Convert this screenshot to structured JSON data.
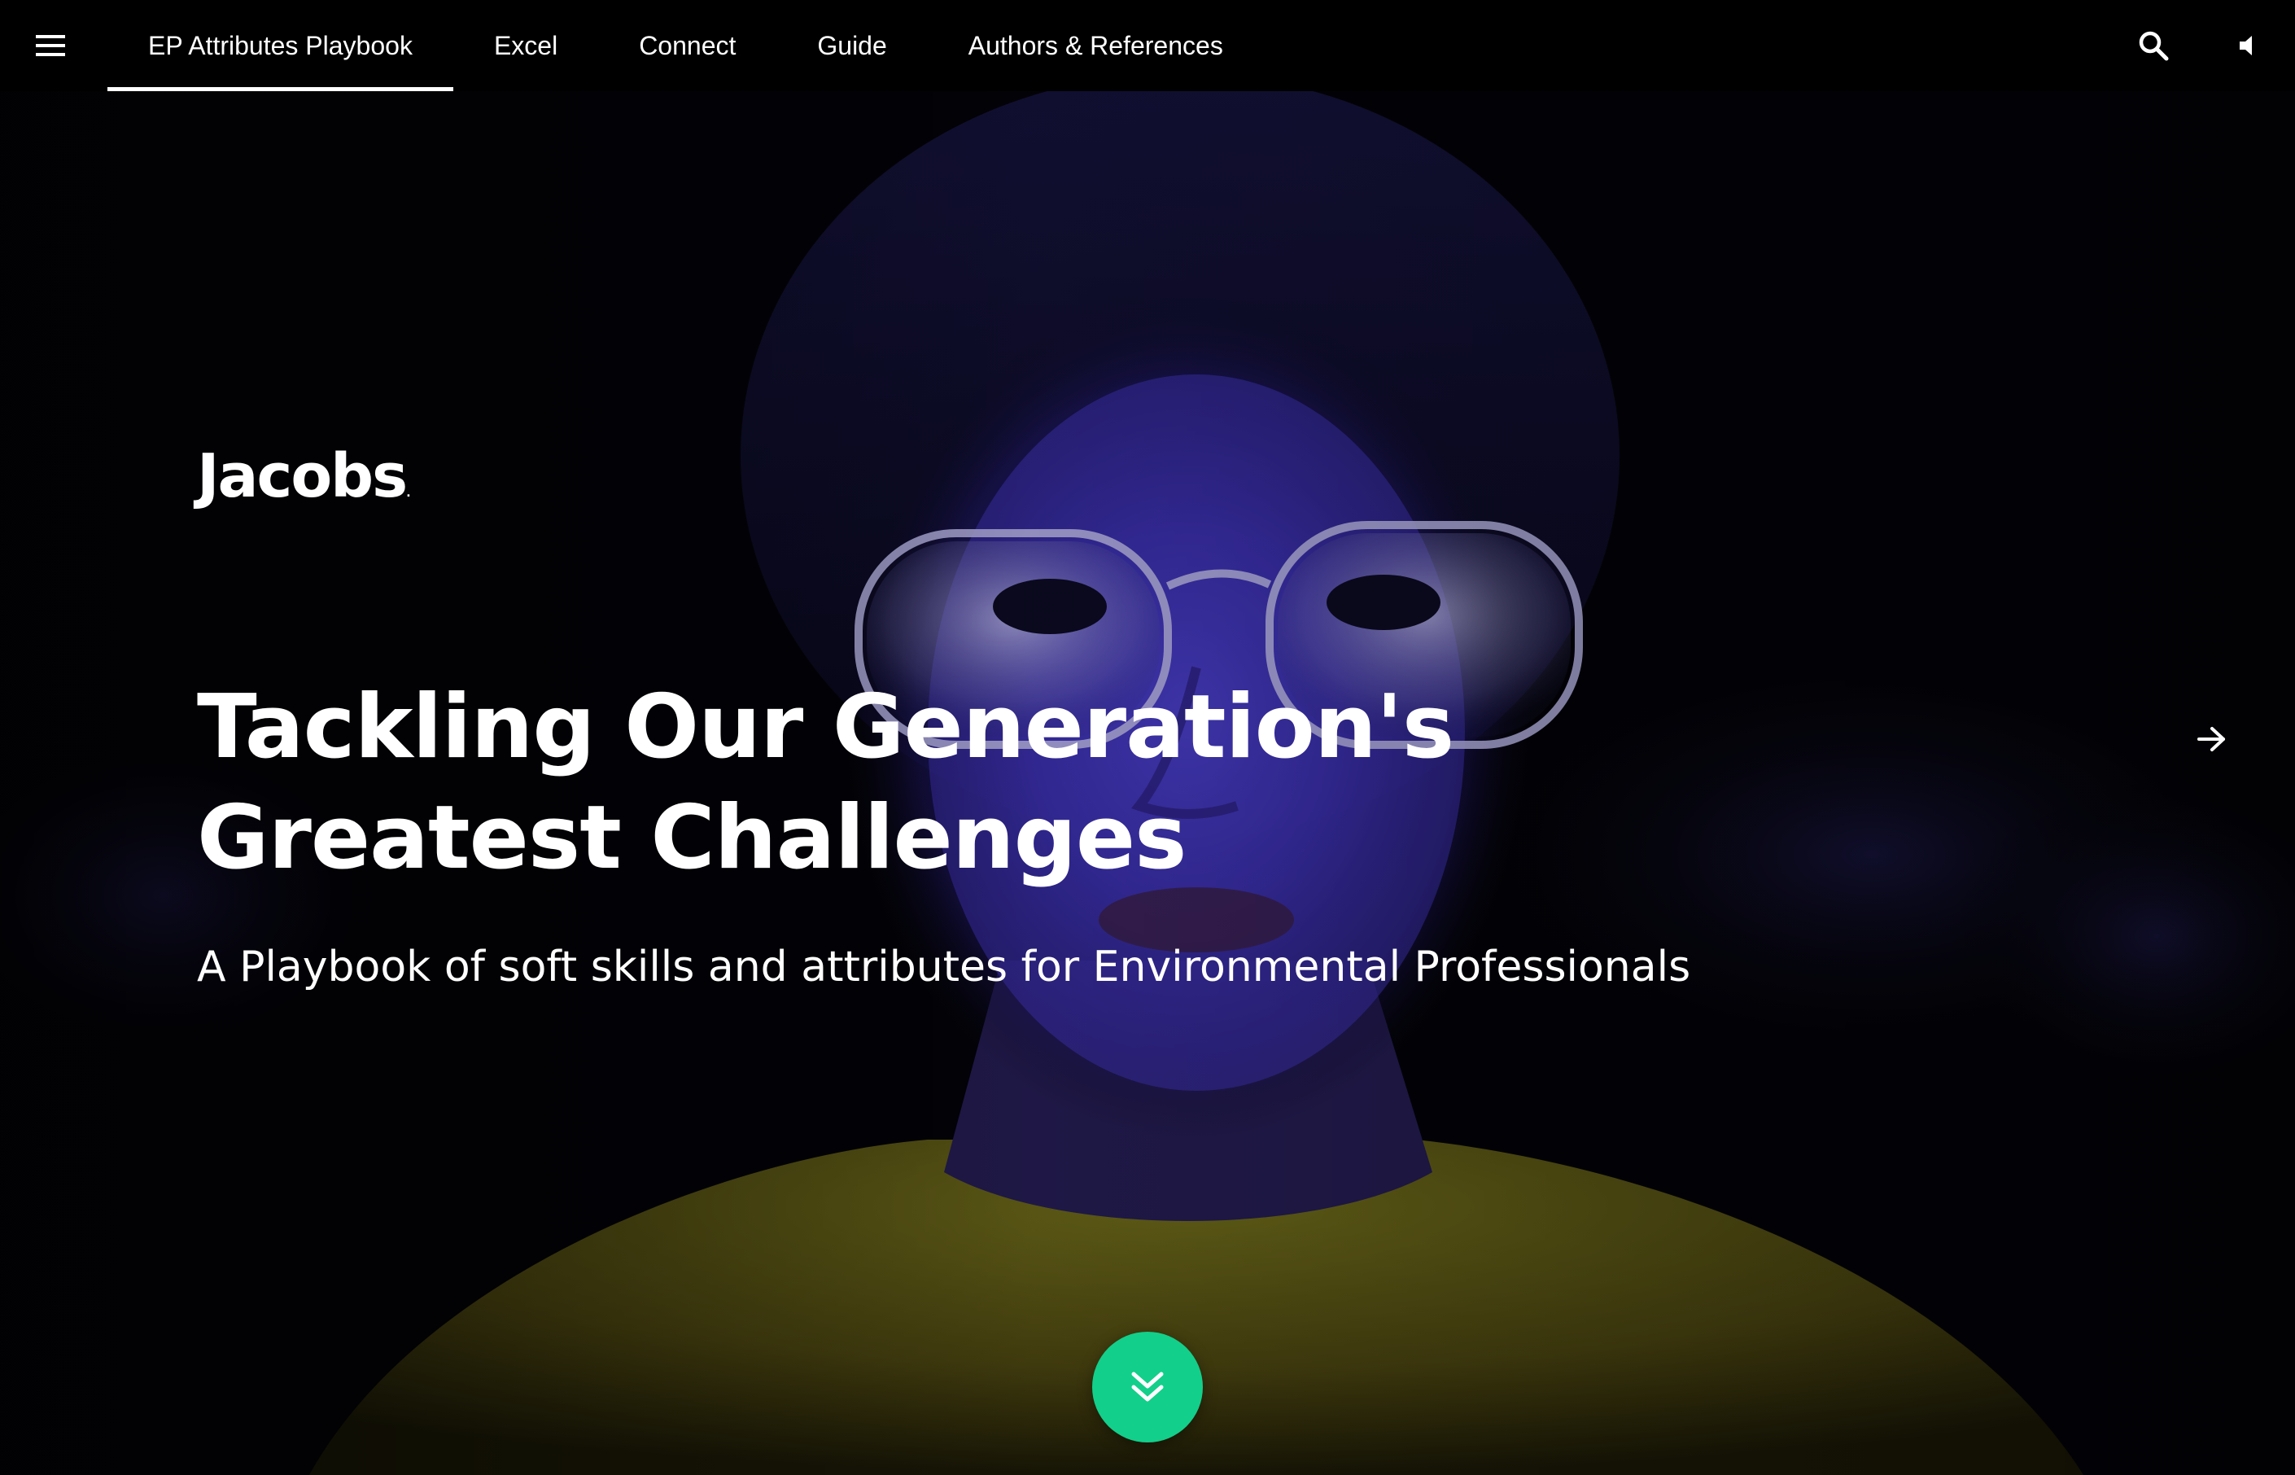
{
  "nav": {
    "menu_icon": "hamburger-menu-icon",
    "tabs": [
      {
        "label": "EP Attributes Playbook",
        "active": true
      },
      {
        "label": "Excel",
        "active": false
      },
      {
        "label": "Connect",
        "active": false
      },
      {
        "label": "Guide",
        "active": false
      },
      {
        "label": "Authors & References",
        "active": false
      }
    ],
    "search_icon": "search-icon",
    "sound_icon": "speaker-icon"
  },
  "hero": {
    "logo_text": "Jacobs",
    "logo_mark": ".",
    "title_line1": "Tackling Our Generation's",
    "title_line2": "Greatest Challenges",
    "subtitle": "A Playbook of soft skills and attributes for Environmental Professionals",
    "next_icon": "arrow-right-icon",
    "scroll_icon": "double-chevron-down-icon"
  },
  "colors": {
    "accent": "#12cf8b",
    "nav_background": "#000000",
    "text": "#ffffff",
    "hero_glow": "#4a3fd9",
    "shirt": "#8a7a1a"
  }
}
